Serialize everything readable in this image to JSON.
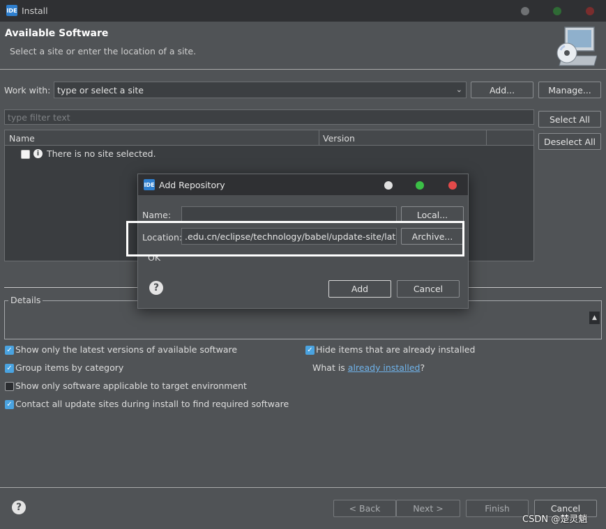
{
  "window": {
    "title": "Install",
    "logo_text": "IDE"
  },
  "header": {
    "title": "Available Software",
    "subtitle": "Select a site or enter the location of a site."
  },
  "work_with": {
    "label": "Work with:",
    "placeholder": "type or select a site",
    "add_label": "Add...",
    "manage_label": "Manage..."
  },
  "filter": {
    "placeholder": "type filter text"
  },
  "selection": {
    "select_all": "Select All",
    "deselect_all": "Deselect All"
  },
  "table": {
    "columns": [
      "Name",
      "Version"
    ],
    "empty_message": "There is no site selected."
  },
  "details": {
    "label": "Details"
  },
  "options": {
    "latest_versions": {
      "label": "Show only the latest versions of available software",
      "checked": true
    },
    "group_by_category": {
      "label": "Group items by category",
      "checked": true
    },
    "target_env": {
      "label": "Show only software applicable to target environment",
      "checked": false
    },
    "contact_sites": {
      "label": "Contact all update sites during install to find required software",
      "checked": true
    },
    "hide_installed": {
      "label": "Hide items that are already installed",
      "checked": true
    },
    "what_is_prefix": "What is ",
    "already_installed_link": "already installed",
    "what_is_suffix": "?"
  },
  "footer": {
    "back": "< Back",
    "next": "Next >",
    "finish": "Finish",
    "cancel": "Cancel"
  },
  "dialog": {
    "title": "Add Repository",
    "logo_text": "IDE",
    "name_label": "Name:",
    "name_value": "",
    "location_label": "Location:",
    "location_value": ".edu.cn/eclipse/technology/babel/update-site/latest/",
    "local_label": "Local...",
    "archive_label": "Archive...",
    "ok_text": "OK",
    "add_label": "Add",
    "cancel_label": "Cancel"
  },
  "watermark": "CSDN @楚灵魈",
  "colors": {
    "background": "#505356",
    "titlebar": "#2f3033",
    "checkbox_on": "#4aa3e0",
    "link": "#6fb3ea",
    "highlight_box": "#ffffff"
  }
}
